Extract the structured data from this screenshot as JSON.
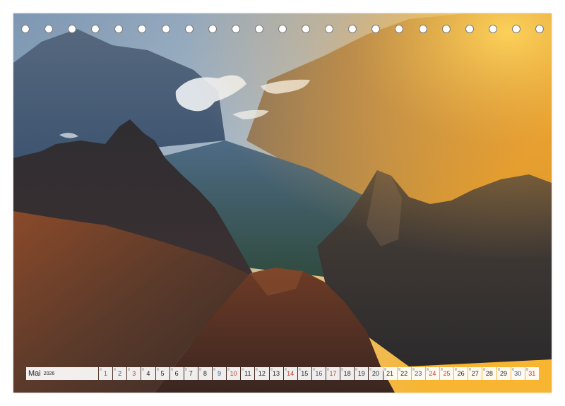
{
  "calendar": {
    "month": "Mai",
    "year": "2026",
    "days": [
      {
        "label": "1",
        "type": "holiday"
      },
      {
        "label": "2",
        "type": "sat"
      },
      {
        "label": "3",
        "type": "sun"
      },
      {
        "label": "4",
        "type": "weekday"
      },
      {
        "label": "5",
        "type": "weekday"
      },
      {
        "label": "6",
        "type": "weekday"
      },
      {
        "label": "7",
        "type": "weekday"
      },
      {
        "label": "8",
        "type": "weekday"
      },
      {
        "label": "9",
        "type": "sat"
      },
      {
        "label": "10",
        "type": "sun"
      },
      {
        "label": "11",
        "type": "weekday"
      },
      {
        "label": "12",
        "type": "weekday"
      },
      {
        "label": "13",
        "type": "weekday"
      },
      {
        "label": "14",
        "type": "holiday"
      },
      {
        "label": "15",
        "type": "weekday"
      },
      {
        "label": "16",
        "type": "sat"
      },
      {
        "label": "17",
        "type": "sun"
      },
      {
        "label": "18",
        "type": "weekday"
      },
      {
        "label": "19",
        "type": "weekday"
      },
      {
        "label": "20",
        "type": "weekday"
      },
      {
        "label": "21",
        "type": "weekday"
      },
      {
        "label": "22",
        "type": "weekday"
      },
      {
        "label": "23",
        "type": "sat"
      },
      {
        "label": "24",
        "type": "sun"
      },
      {
        "label": "25",
        "type": "holiday"
      },
      {
        "label": "26",
        "type": "weekday"
      },
      {
        "label": "27",
        "type": "weekday"
      },
      {
        "label": "28",
        "type": "weekday"
      },
      {
        "label": "29",
        "type": "weekday"
      },
      {
        "label": "30",
        "type": "sat"
      },
      {
        "label": "31",
        "type": "sun"
      }
    ]
  },
  "colors": {
    "sky_glow": "#f6c04a",
    "mountain_dark": "#2c2a2e",
    "valley_blue": "#4d6b8a",
    "earth_red": "#7a3a22",
    "saturday": "#2a4d8f",
    "sunday_holiday": "#c0392b"
  }
}
